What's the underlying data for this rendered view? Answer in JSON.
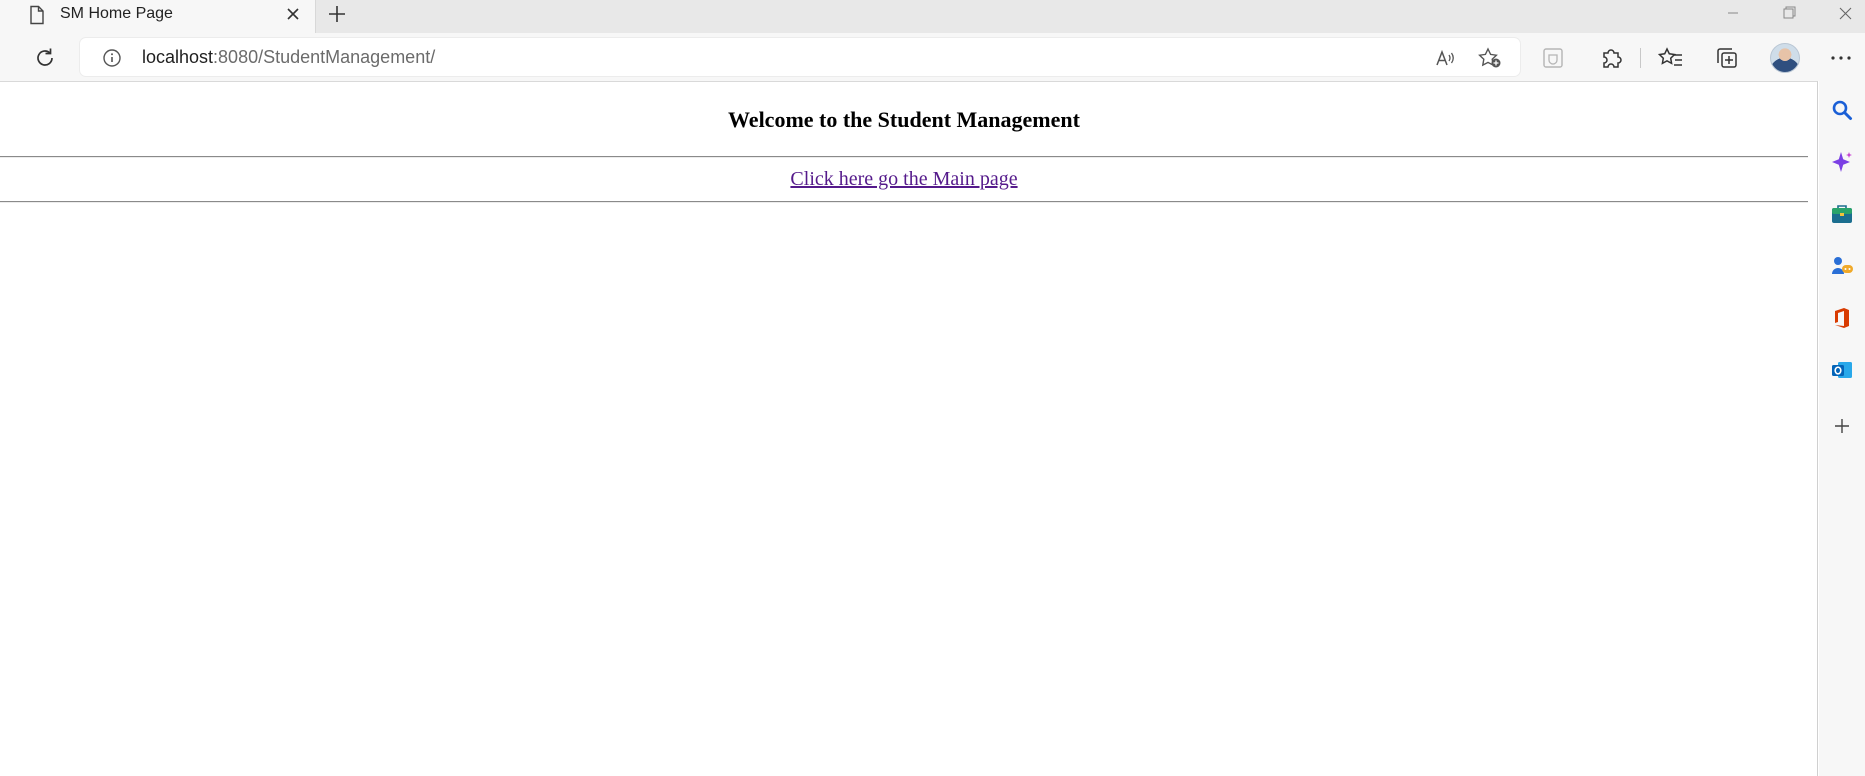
{
  "browser": {
    "tab": {
      "title": "SM Home Page",
      "icon": "page-icon"
    },
    "window_controls": [
      "minimize-icon",
      "restore-icon",
      "close-icon"
    ],
    "address_bar": {
      "host": "localhost",
      "rest": ":8080/StudentManagement/"
    },
    "toolbar_icons": [
      "reload-icon",
      "info-icon",
      "read-aloud-icon",
      "add-favorite-icon",
      "wallet-icon",
      "extensions-icon",
      "favorites-icon",
      "collections-icon",
      "avatar",
      "more-icon"
    ],
    "sidebar_icons": [
      "search-icon",
      "copilot-icon",
      "tools-icon",
      "games-icon",
      "office-icon",
      "outlook-icon",
      "add-icon"
    ]
  },
  "page": {
    "heading": "Welcome to the Student Management",
    "link_text": "Click here go the Main page"
  },
  "colors": {
    "link_visited": "#551a8b",
    "chrome_bg": "#f7f7f7",
    "tab_strip_bg": "#e8e8e8"
  }
}
